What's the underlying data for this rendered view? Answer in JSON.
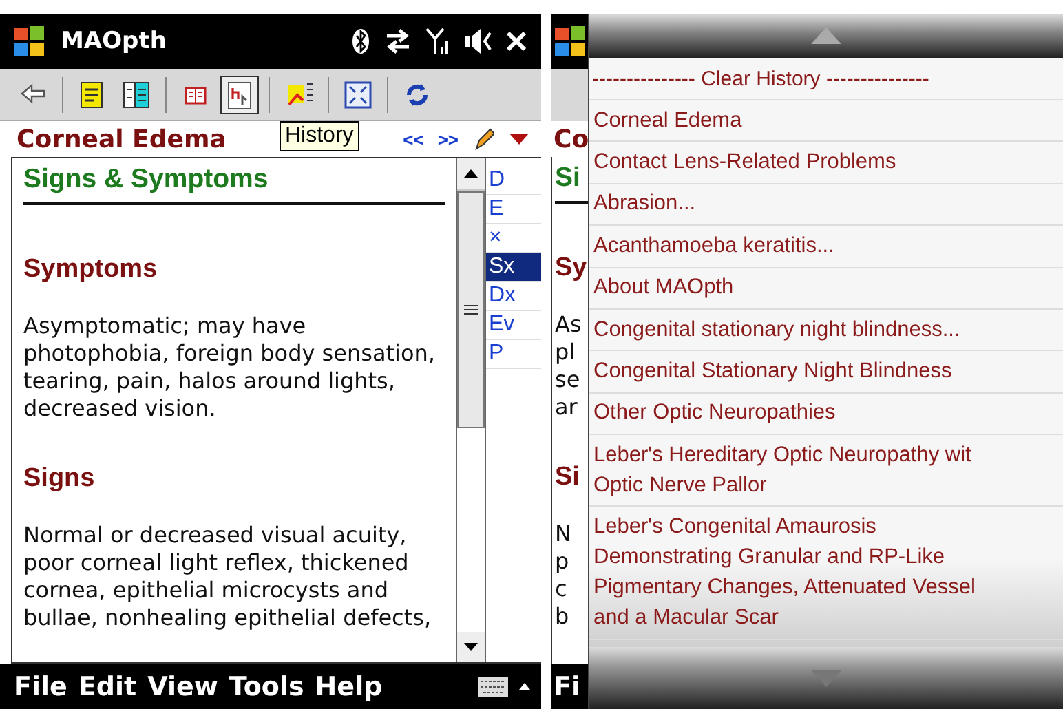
{
  "title_bar": {
    "app_name": "MAOpth"
  },
  "toolbar": {
    "buttons": [
      {
        "kind": "back",
        "selected": false
      },
      {
        "kind": "separator"
      },
      {
        "kind": "note",
        "selected": false
      },
      {
        "kind": "columns",
        "selected": false
      },
      {
        "kind": "separator"
      },
      {
        "kind": "book",
        "selected": false
      },
      {
        "kind": "history",
        "selected": true
      },
      {
        "kind": "separator"
      },
      {
        "kind": "highlight",
        "selected": false
      },
      {
        "kind": "separator"
      },
      {
        "kind": "fullscreen",
        "selected": false
      },
      {
        "kind": "separator"
      },
      {
        "kind": "sync",
        "selected": false
      }
    ],
    "tooltip": "History"
  },
  "document": {
    "title": "Corneal Edema",
    "prev": "<<",
    "next": ">>",
    "sections": [
      {
        "kind": "subtitle",
        "text": "Signs & Symptoms"
      },
      {
        "kind": "heading",
        "text": "Symptoms"
      },
      {
        "kind": "body",
        "text": "Asymptomatic; may have photophobia, foreign body sensation, tearing, pain, halos around lights, decreased vision."
      },
      {
        "kind": "heading",
        "text": "Signs"
      },
      {
        "kind": "body",
        "text": "Normal or decreased visual acuity, poor corneal light reflex, thickened cornea, epithelial microcysts and bullae, nonhealing epithelial defects,"
      }
    ],
    "index": [
      {
        "label": "D",
        "selected": false
      },
      {
        "label": "E",
        "selected": false
      },
      {
        "label": "×",
        "selected": false
      },
      {
        "label": "Sx",
        "selected": true
      },
      {
        "label": "Dx",
        "selected": false
      },
      {
        "label": "Ev",
        "selected": false
      },
      {
        "label": "P",
        "selected": false
      }
    ]
  },
  "menu_bar": [
    "File",
    "Edit",
    "View",
    "Tools",
    "Help"
  ],
  "behind_menu": {
    "title": "Co",
    "sections": [
      {
        "kind": "subtitle",
        "text": "Si"
      },
      {
        "kind": "heading",
        "text": "Sy"
      },
      {
        "kind": "body",
        "text": "As"
      },
      {
        "kind": "body",
        "text": "pl"
      },
      {
        "kind": "body",
        "text": "se"
      },
      {
        "kind": "body",
        "text": "ar"
      },
      {
        "kind": "heading",
        "text": "Si"
      },
      {
        "kind": "body",
        "text": "N"
      },
      {
        "kind": "body",
        "text": "p"
      },
      {
        "kind": "body",
        "text": "c"
      },
      {
        "kind": "body",
        "text": "b"
      }
    ],
    "menu": "Fi"
  },
  "history_menu": {
    "header": "--------------- Clear History ---------------",
    "items": [
      {
        "lines": [
          "Corneal Edema"
        ]
      },
      {
        "lines": [
          "Contact Lens-Related Problems"
        ]
      },
      {
        "lines": [
          "Abrasion..."
        ]
      },
      {
        "lines": [
          "Acanthamoeba keratitis..."
        ]
      },
      {
        "lines": [
          "About MAOpth"
        ]
      },
      {
        "lines": [
          "Congenital stationary night blindness..."
        ]
      },
      {
        "lines": [
          "Congenital Stationary Night Blindness"
        ]
      },
      {
        "lines": [
          "Other Optic Neuropathies"
        ]
      },
      {
        "lines": [
          "Leber's Hereditary Optic Neuropathy wit",
          "Optic Nerve Pallor"
        ]
      },
      {
        "lines": [
          "Leber's Congenital Amaurosis",
          "Demonstrating Granular and RP-Like",
          "Pigmentary Changes, Attenuated Vessel",
          "and a Macular Scar"
        ]
      }
    ]
  }
}
